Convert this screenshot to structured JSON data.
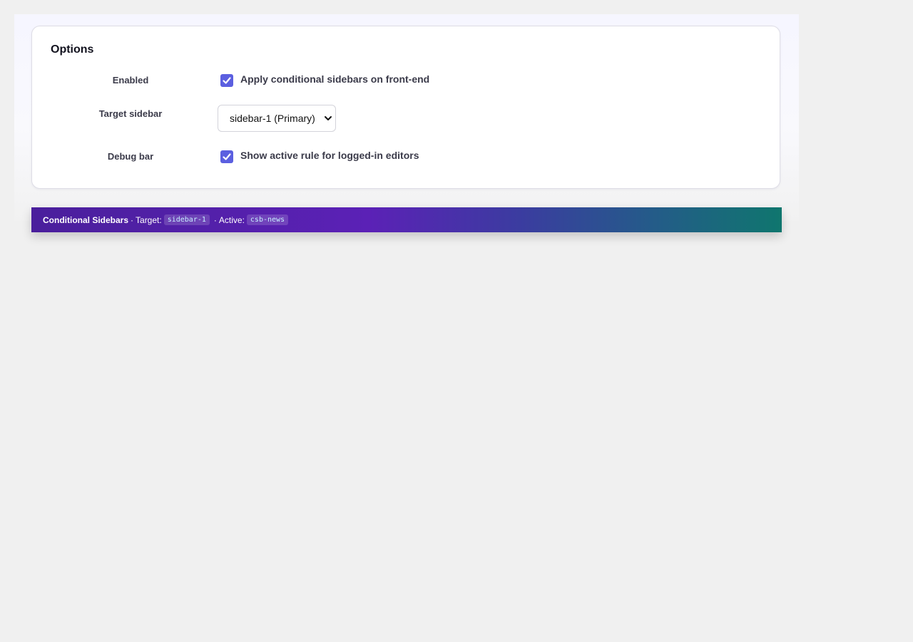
{
  "options": {
    "title": "Options",
    "rows": [
      {
        "label": "Enabled",
        "control": "checkbox",
        "checked": true,
        "text": "Apply conditional sidebars on front-end"
      },
      {
        "label": "Target sidebar",
        "control": "select",
        "selected": "sidebar-1 (Primary)"
      },
      {
        "label": "Debug bar",
        "control": "checkbox",
        "checked": true,
        "text": "Show active rule for logged-in editors"
      }
    ]
  },
  "debug_bar": {
    "brand": "Conditional Sidebars",
    "target_label": "Target:",
    "target_value": "sidebar-1",
    "active_label": "Active:",
    "active_value": "csb-news",
    "separator": "·"
  },
  "colors": {
    "accent": "#5b5fe0",
    "bar_start": "#4a1f9c",
    "bar_end": "#0f766e"
  },
  "icons": {
    "checkbox": "checkmark-icon",
    "select": "chevron-down-icon"
  }
}
